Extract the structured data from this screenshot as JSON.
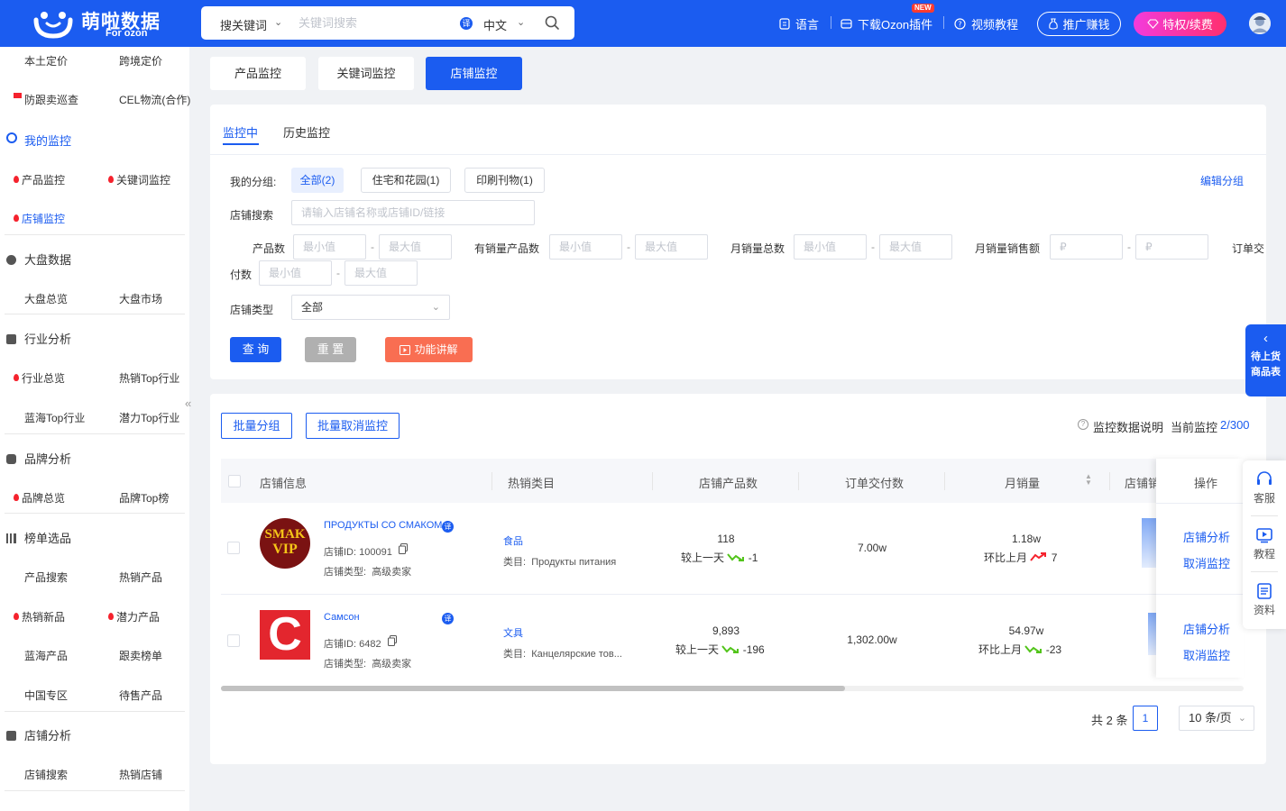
{
  "header": {
    "logo_text": "萌啦数据",
    "logo_sub": "For ozon",
    "search": {
      "type_label": "搜关键词",
      "placeholder": "关键词搜索",
      "translate_badge": "译",
      "language": "中文"
    },
    "nav": {
      "language": "语言",
      "download_plugin": "下载Ozon插件",
      "new_badge": "NEW",
      "video_tutorial": "视频教程",
      "promote": "推广赚钱",
      "vip": "特权/续费"
    }
  },
  "sidebar": {
    "row1": [
      "本土定价",
      "跨境定价"
    ],
    "row2": [
      "防跟卖巡查",
      "CEL物流(合作)"
    ],
    "my_monitor": "我的监控",
    "monitor_items": [
      "产品监控",
      "关键词监控",
      "店铺监控"
    ],
    "market": "大盘数据",
    "market_items": [
      "大盘总览",
      "大盘市场"
    ],
    "industry": "行业分析",
    "industry_items": [
      "行业总览",
      "热销Top行业",
      "蓝海Top行业",
      "潜力Top行业"
    ],
    "brand": "品牌分析",
    "brand_items": [
      "品牌总览",
      "品牌Top榜"
    ],
    "ranking": "榜单选品",
    "ranking_items": [
      "产品搜索",
      "热销产品",
      "热销新品",
      "潜力产品",
      "蓝海产品",
      "跟卖榜单",
      "中国专区",
      "待售产品"
    ],
    "shop_analysis": "店铺分析",
    "shop_items": [
      "店铺搜索",
      "热销店铺"
    ]
  },
  "tabs": [
    "产品监控",
    "关键词监控",
    "店铺监控"
  ],
  "filter": {
    "subtabs": [
      "监控中",
      "历史监控"
    ],
    "group_label": "我的分组:",
    "groups": [
      "全部(2)",
      "住宅和花园(1)",
      "印刷刊物(1)"
    ],
    "edit_group": "编辑分组",
    "shop_search_label": "店铺搜索",
    "shop_search_placeholder": "请输入店铺名称或店铺ID/链接",
    "product_count_label": "产品数",
    "sales_product_label": "有销量产品数",
    "monthly_sales_label": "月销量总数",
    "monthly_revenue_label": "月销量销售额",
    "order_label_a": "订单交",
    "order_label_b": "付数",
    "min_placeholder": "最小值",
    "max_placeholder": "最大值",
    "ruble_placeholder": "₽",
    "shop_type_label": "店铺类型",
    "shop_type_value": "全部",
    "query": "查 询",
    "reset": "重 置",
    "explain": "功能讲解"
  },
  "list": {
    "batch_group": "批量分组",
    "batch_cancel": "批量取消监控",
    "data_note": "监控数据说明",
    "current_label": "当前监控",
    "current_value": "2/300",
    "columns": [
      "店铺信息",
      "热销类目",
      "店铺产品数",
      "订单交付数",
      "月销量",
      "店铺销",
      "操作"
    ],
    "rows": [
      {
        "name": "ПРОДУКТЫ СО СМАКОМ",
        "logo_line1": "SMAK",
        "logo_line2": "VIP",
        "id_label": "店铺ID:",
        "id": "100091",
        "type_label": "店铺类型:",
        "type": "高级卖家",
        "category": "食品",
        "category_label": "类目:",
        "category_ru": "Продукты питания",
        "products": "118",
        "products_cmp": "较上一天",
        "products_delta": "-1",
        "orders": "7.00w",
        "monthly": "1.18w",
        "monthly_cmp": "环比上月",
        "monthly_delta": "7",
        "action_analysis": "店铺分析",
        "action_cancel": "取消监控"
      },
      {
        "name": "Самсон",
        "logo_line1": "C",
        "id_label": "店铺ID:",
        "id": "6482",
        "type_label": "店铺类型:",
        "type": "高级卖家",
        "category": "文具",
        "category_label": "类目:",
        "category_ru": "Канцелярские тов...",
        "products": "9,893",
        "products_cmp": "较上一天",
        "products_delta": "-196",
        "orders": "1,302.00w",
        "monthly": "54.97w",
        "monthly_cmp": "环比上月",
        "monthly_delta": "-23",
        "action_analysis": "店铺分析",
        "action_cancel": "取消监控"
      }
    ],
    "total": "共 2 条",
    "page": "1",
    "page_size": "10 条/页"
  },
  "floating": {
    "pending_line1": "待上货",
    "pending_line2": "商品表",
    "service": "客服",
    "tutorial": "教程",
    "material": "资料"
  },
  "colors": {
    "primary": "#1b5cf0",
    "up": "#f5222d",
    "down": "#52c41a",
    "vip_gradient": [
      "#f33bdc",
      "#ff2f6e"
    ]
  }
}
